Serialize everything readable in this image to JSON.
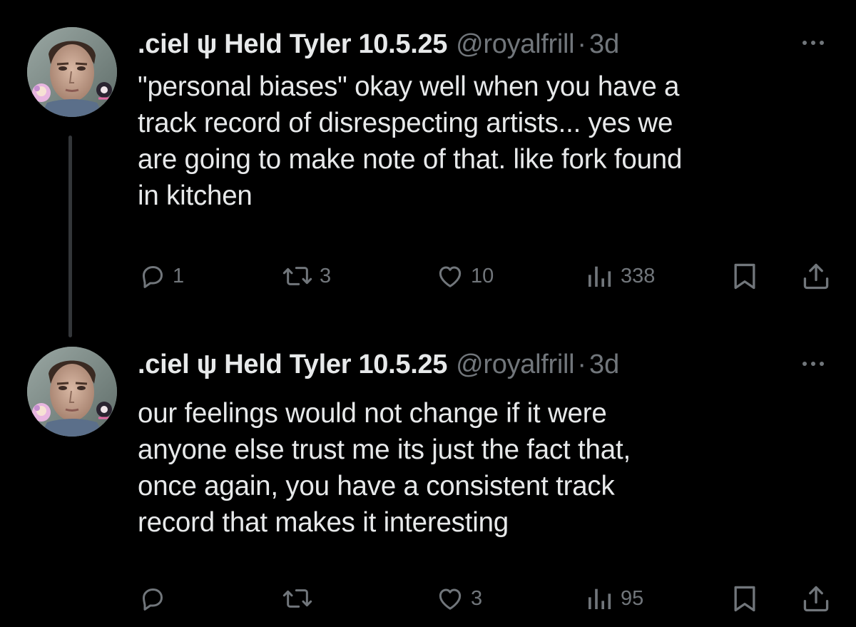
{
  "colors": {
    "background": "#000000",
    "primary_text": "#e7e9ea",
    "secondary_text": "#71767b",
    "thread_line": "#333639"
  },
  "tweets": [
    {
      "display_name": ".ciel ψ Held Tyler 10.5.25",
      "handle": "@royalfrill",
      "separator": "·",
      "time": "3d",
      "text": "\"personal biases\" okay well when you have a track record of disrespecting artists... yes we are going to make note of that. like fork found in kitchen",
      "text_lines": [
        "\"personal biases\" okay well when you have a",
        "track record of disrespecting artists... yes we",
        "are going to make note of that. like fork found",
        "in kitchen"
      ],
      "avatar_icon": "avatar-photo",
      "more_icon": "more-dots-icon",
      "actions": {
        "replies": "1",
        "reposts": "3",
        "likes": "10",
        "views": "338"
      }
    },
    {
      "display_name": ".ciel ψ Held Tyler 10.5.25",
      "handle": "@royalfrill",
      "separator": "·",
      "time": "3d",
      "text": "our feelings would not change if it were anyone else trust me its just the fact that, once again, you have a consistent track record that makes it interesting",
      "text_lines": [
        "our feelings would not change if it were",
        "anyone else trust me its just the fact that,",
        "once again, you have a consistent track",
        "record that makes it interesting"
      ],
      "avatar_icon": "avatar-photo",
      "more_icon": "more-dots-icon",
      "actions": {
        "replies": "",
        "reposts": "",
        "likes": "3",
        "views": "95"
      }
    }
  ]
}
